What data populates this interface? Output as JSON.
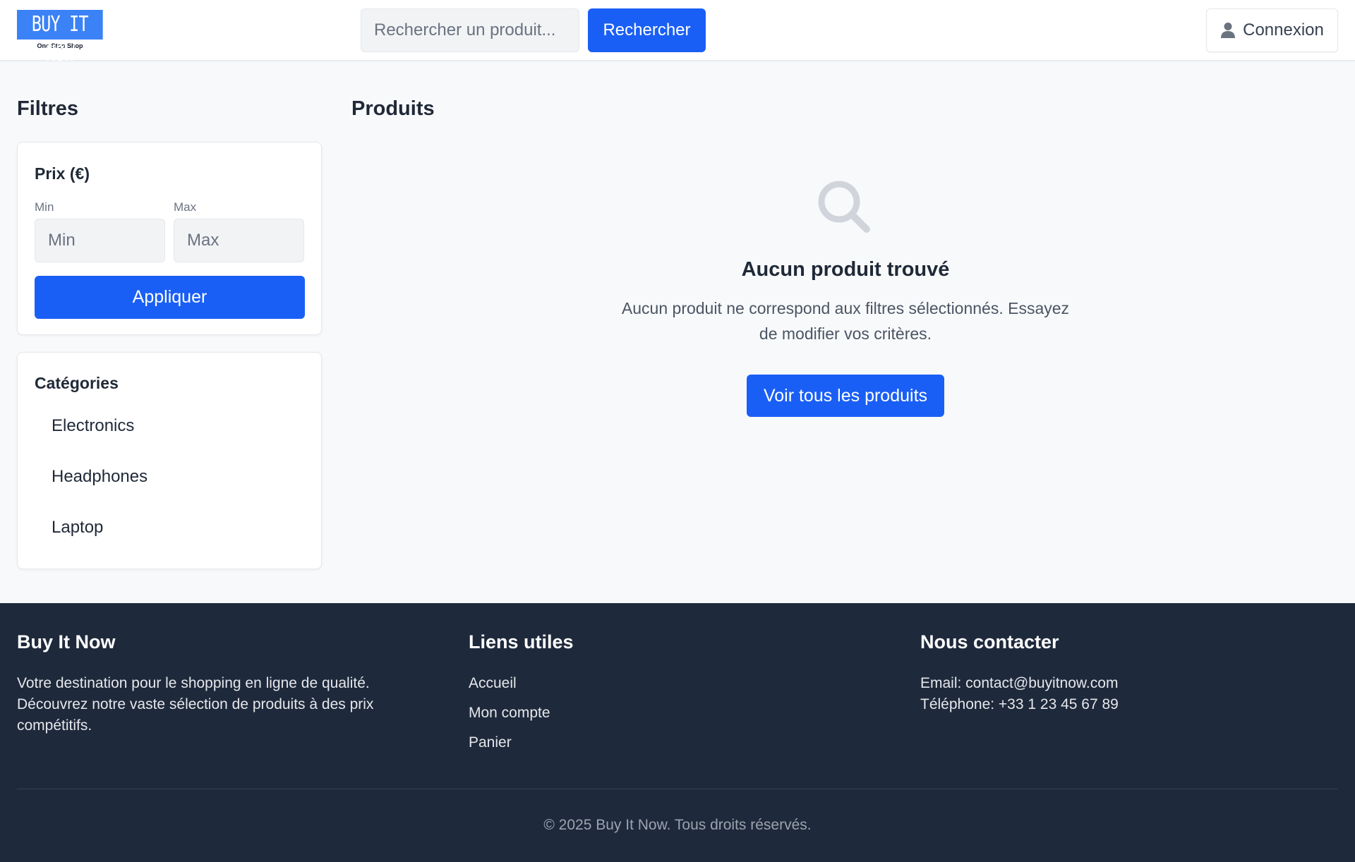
{
  "header": {
    "logo_text": "BUY IT NOW",
    "logo_tagline": "One Stop Shop",
    "search_placeholder": "Rechercher un produit...",
    "search_button": "Rechercher",
    "login_button": "Connexion",
    "login_icon": "user-icon"
  },
  "sidebar": {
    "title": "Filtres",
    "price": {
      "title": "Prix (€)",
      "min_label": "Min",
      "min_placeholder": "Min",
      "max_label": "Max",
      "max_placeholder": "Max",
      "apply_button": "Appliquer"
    },
    "categories": {
      "title": "Catégories",
      "items": [
        "Electronics",
        "Headphones",
        "Laptop"
      ]
    }
  },
  "main": {
    "title": "Produits",
    "empty": {
      "icon": "search-icon",
      "title": "Aucun produit trouvé",
      "text": "Aucun produit ne correspond aux filtres sélectionnés. Essayez de modifier vos critères.",
      "button": "Voir tous les produits"
    }
  },
  "footer": {
    "brand": {
      "heading": "Buy It Now",
      "text": "Votre destination pour le shopping en ligne de qualité. Découvrez notre vaste sélection de produits à des prix compétitifs."
    },
    "links": {
      "heading": "Liens utiles",
      "items": [
        "Accueil",
        "Mon compte",
        "Panier"
      ]
    },
    "contact": {
      "heading": "Nous contacter",
      "email": "Email: contact@buyitnow.com",
      "phone": "Téléphone: +33 1 23 45 67 89"
    },
    "copyright": "© 2025 Buy It Now. Tous droits réservés."
  },
  "colors": {
    "primary": "#1a5ff5",
    "logo_blue": "#3b82f6",
    "footer_bg": "#1e293b",
    "page_bg": "#f8f9fb"
  }
}
